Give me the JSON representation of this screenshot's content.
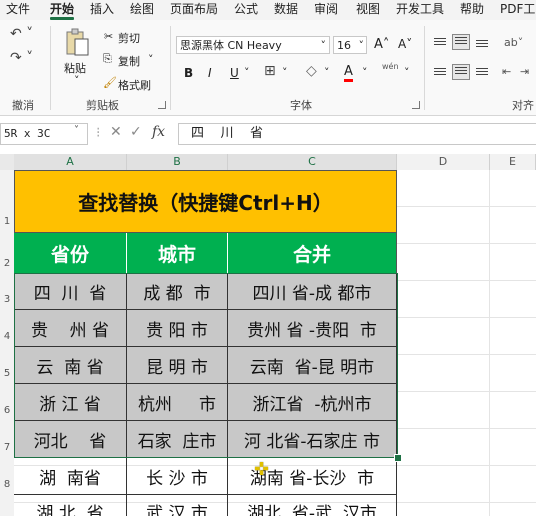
{
  "tabs": [
    "文件",
    "开始",
    "插入",
    "绘图",
    "页面布局",
    "公式",
    "数据",
    "审阅",
    "视图",
    "开发工具",
    "帮助",
    "PDF工"
  ],
  "active_tab": "开始",
  "ribbon": {
    "undo_label": "撤消",
    "clipboard": {
      "paste": "粘贴",
      "cut": "剪切",
      "copy": "复制",
      "format_painter": "格式刷",
      "group_label": "剪贴板"
    },
    "font": {
      "name": "思源黑体 CN Heavy",
      "size": "16",
      "grow": "A˄",
      "shrink": "A˅",
      "bold": "B",
      "italic": "I",
      "underline": "U",
      "font_color_letter": "A",
      "font_color": "#ff0000",
      "phonetic": "wén",
      "group_label": "字体"
    },
    "align_label": "对齐"
  },
  "formula_bar": {
    "name_box": "5R x 3C",
    "fx": "fx",
    "content": "四    川    省"
  },
  "columns": [
    "A",
    "B",
    "C",
    "D",
    "E"
  ],
  "rows": [
    "1",
    "2",
    "3",
    "4",
    "5",
    "6",
    "7",
    "8"
  ],
  "sheet": {
    "title": "查找替换（快捷键Ctrl+H）",
    "headers": [
      "省份",
      "城市",
      "合并"
    ],
    "data": [
      [
        "四  川  省",
        "成 都  市",
        "四川 省-成 都市"
      ],
      [
        "贵    州 省",
        "贵 阳 市",
        "贵州 省 -贵阳  市"
      ],
      [
        "云  南 省",
        "昆 明 市",
        "云南  省-昆 明市"
      ],
      [
        "浙 江 省",
        "杭州     市",
        "浙江省  -杭州市"
      ],
      [
        "河北    省",
        "石家  庄市",
        "河 北省-石家庄 市"
      ],
      [
        "湖  南省",
        "长 沙 市",
        "湖南 省-长沙  市"
      ],
      [
        "湖 北  省",
        "武 汉 市",
        "湖北  省-武  汉市"
      ]
    ],
    "title_bg": "#ffc000",
    "header_bg": "#00b050",
    "selection_fill": "#c8c8c8",
    "selection_border": "#1e7145"
  }
}
